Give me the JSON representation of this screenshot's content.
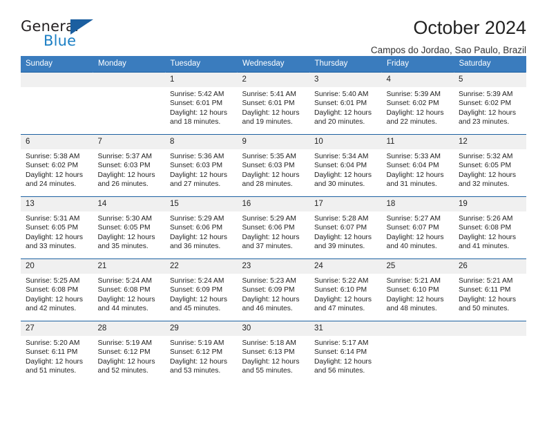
{
  "brand": {
    "name_top": "General",
    "name_bottom": "Blue",
    "triangle_icon": "triangle-icon",
    "color_dark": "#231f20",
    "color_blue": "#1c7fc4",
    "color_triangle": "#1b5fa0"
  },
  "header": {
    "title": "October 2024",
    "subtitle": "Campos do Jordao, Sao Paulo, Brazil"
  },
  "theme": {
    "header_bg": "#3a7cbe",
    "header_text": "#ffffff",
    "daynum_bg": "#f0f0f0",
    "row_divider": "#1b5fa0"
  },
  "weekdays": [
    "Sunday",
    "Monday",
    "Tuesday",
    "Wednesday",
    "Thursday",
    "Friday",
    "Saturday"
  ],
  "weeks": [
    [
      {
        "day": "",
        "details": ""
      },
      {
        "day": "",
        "details": ""
      },
      {
        "day": "1",
        "details": "Sunrise: 5:42 AM\nSunset: 6:01 PM\nDaylight: 12 hours\nand 18 minutes."
      },
      {
        "day": "2",
        "details": "Sunrise: 5:41 AM\nSunset: 6:01 PM\nDaylight: 12 hours\nand 19 minutes."
      },
      {
        "day": "3",
        "details": "Sunrise: 5:40 AM\nSunset: 6:01 PM\nDaylight: 12 hours\nand 20 minutes."
      },
      {
        "day": "4",
        "details": "Sunrise: 5:39 AM\nSunset: 6:02 PM\nDaylight: 12 hours\nand 22 minutes."
      },
      {
        "day": "5",
        "details": "Sunrise: 5:39 AM\nSunset: 6:02 PM\nDaylight: 12 hours\nand 23 minutes."
      }
    ],
    [
      {
        "day": "6",
        "details": "Sunrise: 5:38 AM\nSunset: 6:02 PM\nDaylight: 12 hours\nand 24 minutes."
      },
      {
        "day": "7",
        "details": "Sunrise: 5:37 AM\nSunset: 6:03 PM\nDaylight: 12 hours\nand 26 minutes."
      },
      {
        "day": "8",
        "details": "Sunrise: 5:36 AM\nSunset: 6:03 PM\nDaylight: 12 hours\nand 27 minutes."
      },
      {
        "day": "9",
        "details": "Sunrise: 5:35 AM\nSunset: 6:03 PM\nDaylight: 12 hours\nand 28 minutes."
      },
      {
        "day": "10",
        "details": "Sunrise: 5:34 AM\nSunset: 6:04 PM\nDaylight: 12 hours\nand 30 minutes."
      },
      {
        "day": "11",
        "details": "Sunrise: 5:33 AM\nSunset: 6:04 PM\nDaylight: 12 hours\nand 31 minutes."
      },
      {
        "day": "12",
        "details": "Sunrise: 5:32 AM\nSunset: 6:05 PM\nDaylight: 12 hours\nand 32 minutes."
      }
    ],
    [
      {
        "day": "13",
        "details": "Sunrise: 5:31 AM\nSunset: 6:05 PM\nDaylight: 12 hours\nand 33 minutes."
      },
      {
        "day": "14",
        "details": "Sunrise: 5:30 AM\nSunset: 6:05 PM\nDaylight: 12 hours\nand 35 minutes."
      },
      {
        "day": "15",
        "details": "Sunrise: 5:29 AM\nSunset: 6:06 PM\nDaylight: 12 hours\nand 36 minutes."
      },
      {
        "day": "16",
        "details": "Sunrise: 5:29 AM\nSunset: 6:06 PM\nDaylight: 12 hours\nand 37 minutes."
      },
      {
        "day": "17",
        "details": "Sunrise: 5:28 AM\nSunset: 6:07 PM\nDaylight: 12 hours\nand 39 minutes."
      },
      {
        "day": "18",
        "details": "Sunrise: 5:27 AM\nSunset: 6:07 PM\nDaylight: 12 hours\nand 40 minutes."
      },
      {
        "day": "19",
        "details": "Sunrise: 5:26 AM\nSunset: 6:08 PM\nDaylight: 12 hours\nand 41 minutes."
      }
    ],
    [
      {
        "day": "20",
        "details": "Sunrise: 5:25 AM\nSunset: 6:08 PM\nDaylight: 12 hours\nand 42 minutes."
      },
      {
        "day": "21",
        "details": "Sunrise: 5:24 AM\nSunset: 6:08 PM\nDaylight: 12 hours\nand 44 minutes."
      },
      {
        "day": "22",
        "details": "Sunrise: 5:24 AM\nSunset: 6:09 PM\nDaylight: 12 hours\nand 45 minutes."
      },
      {
        "day": "23",
        "details": "Sunrise: 5:23 AM\nSunset: 6:09 PM\nDaylight: 12 hours\nand 46 minutes."
      },
      {
        "day": "24",
        "details": "Sunrise: 5:22 AM\nSunset: 6:10 PM\nDaylight: 12 hours\nand 47 minutes."
      },
      {
        "day": "25",
        "details": "Sunrise: 5:21 AM\nSunset: 6:10 PM\nDaylight: 12 hours\nand 48 minutes."
      },
      {
        "day": "26",
        "details": "Sunrise: 5:21 AM\nSunset: 6:11 PM\nDaylight: 12 hours\nand 50 minutes."
      }
    ],
    [
      {
        "day": "27",
        "details": "Sunrise: 5:20 AM\nSunset: 6:11 PM\nDaylight: 12 hours\nand 51 minutes."
      },
      {
        "day": "28",
        "details": "Sunrise: 5:19 AM\nSunset: 6:12 PM\nDaylight: 12 hours\nand 52 minutes."
      },
      {
        "day": "29",
        "details": "Sunrise: 5:19 AM\nSunset: 6:12 PM\nDaylight: 12 hours\nand 53 minutes."
      },
      {
        "day": "30",
        "details": "Sunrise: 5:18 AM\nSunset: 6:13 PM\nDaylight: 12 hours\nand 55 minutes."
      },
      {
        "day": "31",
        "details": "Sunrise: 5:17 AM\nSunset: 6:14 PM\nDaylight: 12 hours\nand 56 minutes."
      },
      {
        "day": "",
        "details": ""
      },
      {
        "day": "",
        "details": ""
      }
    ]
  ]
}
